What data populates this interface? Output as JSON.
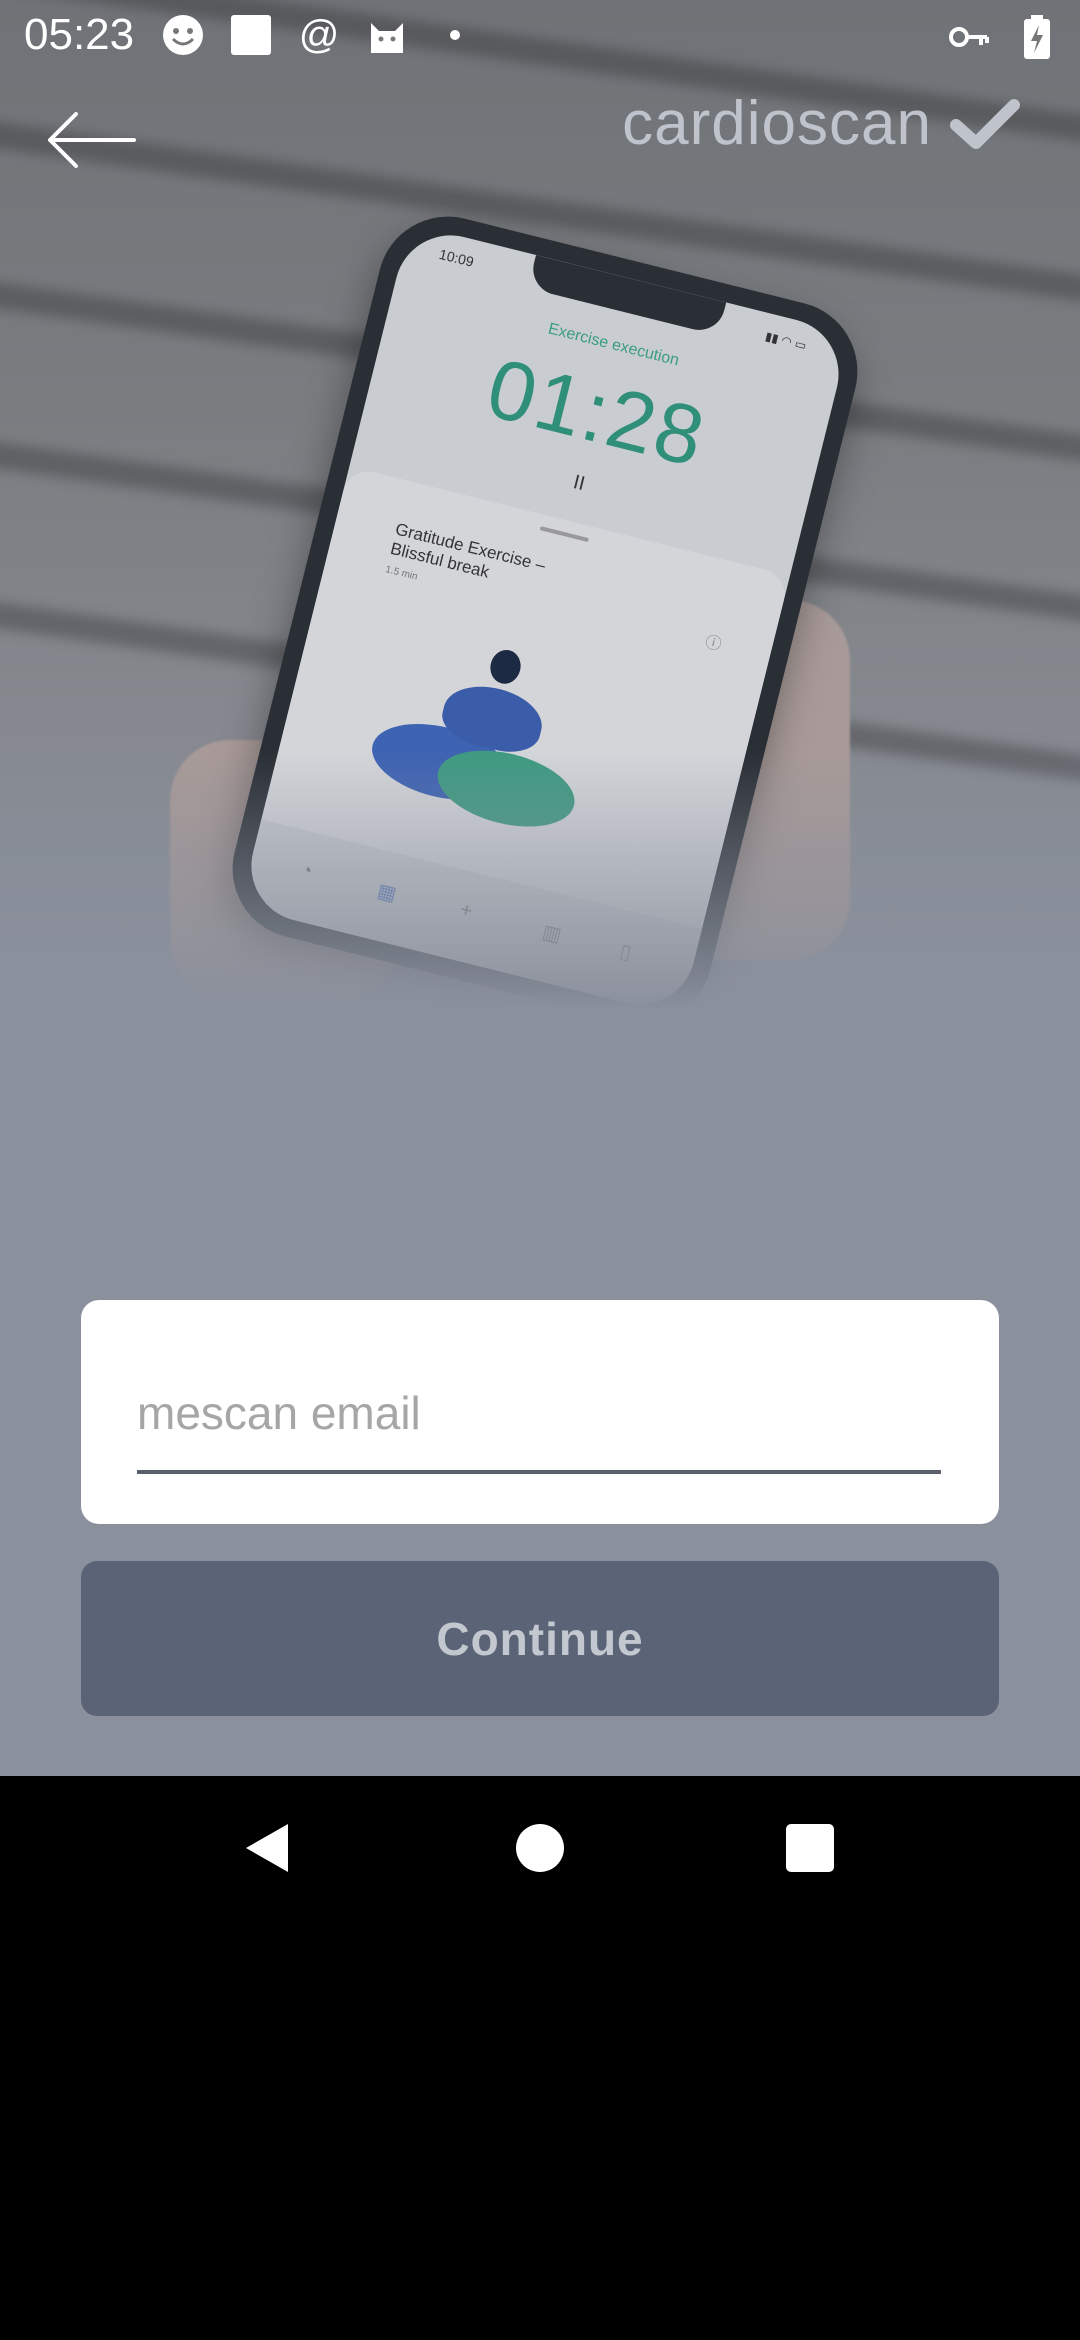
{
  "status_bar": {
    "time": "05:23",
    "left_icons": [
      "smiley-icon",
      "square-icon",
      "at-icon",
      "cat-icon",
      "dot-icon"
    ],
    "right_icons": [
      "key-icon",
      "battery-charging-icon"
    ]
  },
  "header": {
    "back_icon": "arrow-left-icon",
    "brand_name": "cardioscan",
    "brand_icon": "checkmark-icon"
  },
  "background_phone": {
    "time": "10:09",
    "title": "Exercise execution",
    "timer": "01:28",
    "pause": "II",
    "exercise_title": "Gratitude Exercise – Blissful break",
    "exercise_duration": "1.5 min"
  },
  "form": {
    "email_placeholder": "mescan email",
    "email_value": "",
    "continue_label": "Continue"
  },
  "nav_bar": {
    "buttons": [
      "back-triangle-icon",
      "home-circle-icon",
      "recents-square-icon"
    ]
  },
  "colors": {
    "overlay": "#8a909c",
    "button": "#5b6476",
    "button_text": "#c3c7cf",
    "accent_green": "#2f8f78"
  }
}
